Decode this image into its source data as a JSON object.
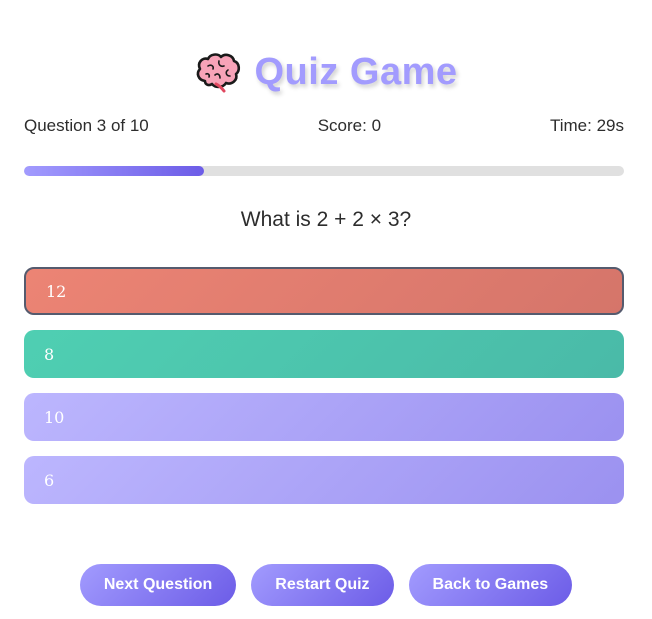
{
  "header": {
    "icon": "brain-icon",
    "title": "Quiz Game"
  },
  "stats": {
    "question_label": "Question 3 of 10",
    "score_label": "Score: 0",
    "time_label": "Time: 29s"
  },
  "progress": {
    "fraction": 0.3
  },
  "question": {
    "text": "What is 2 + 2 × 3?"
  },
  "options": [
    {
      "label": "12",
      "state": "wrong"
    },
    {
      "label": "8",
      "state": "correct"
    },
    {
      "label": "10",
      "state": "neutral"
    },
    {
      "label": "6",
      "state": "neutral"
    }
  ],
  "actions": {
    "next_label": "Next Question",
    "restart_label": "Restart Quiz",
    "back_label": "Back to Games"
  },
  "colors": {
    "accent": "#a29bfe",
    "accent_dark": "#6c5ce7",
    "wrong": "#e17f72",
    "correct": "#4cc6ad"
  }
}
